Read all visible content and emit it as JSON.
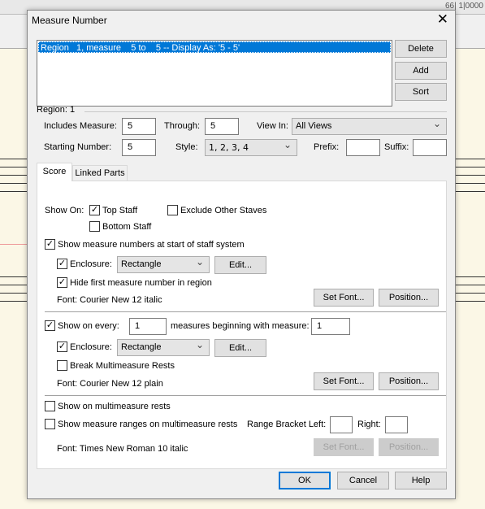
{
  "background": {
    "counter": "66| 1|0000"
  },
  "dialog": {
    "title": "Measure Number",
    "regions": [
      "Region   1, measure    5 to    5 -- Display As: '5 - 5'"
    ],
    "buttons": {
      "delete": "Delete",
      "add": "Add",
      "sort": "Sort",
      "ok": "OK",
      "cancel": "Cancel",
      "help": "Help"
    },
    "region_label": "Region: 1",
    "includes_label": "Includes Measure:",
    "includes_value": "5",
    "through_label": "Through:",
    "through_value": "5",
    "viewin_label": "View In:",
    "viewin_value": "All Views",
    "starting_label": "Starting Number:",
    "starting_value": "5",
    "style_label": "Style:",
    "style_value": "1, 2, 3, 4",
    "prefix_label": "Prefix:",
    "prefix_value": "",
    "suffix_label": "Suffix:",
    "suffix_value": "",
    "tabs": [
      "Score",
      "Linked Parts"
    ],
    "score": {
      "show_on": "Show On:",
      "top_staff": "Top Staff",
      "top_staff_checked": true,
      "exclude": "Exclude Other Staves",
      "exclude_checked": false,
      "bottom_staff": "Bottom Staff",
      "bottom_staff_checked": false,
      "s1": {
        "show_start": "Show measure numbers at start of staff system",
        "show_start_checked": true,
        "enclosure": "Enclosure:",
        "enclosure_checked": true,
        "enclosure_value": "Rectangle",
        "edit": "Edit...",
        "hide_first": "Hide first measure number in region",
        "hide_first_checked": true,
        "font": "Font:  Courier New  12  italic",
        "set_font": "Set Font...",
        "position": "Position..."
      },
      "s2": {
        "show_every": "Show on every:",
        "show_every_checked": true,
        "every_value": "1",
        "beginning": "measures beginning with measure:",
        "beginning_value": "1",
        "enclosure": "Enclosure:",
        "enclosure_checked": true,
        "enclosure_value": "Rectangle",
        "edit": "Edit...",
        "break": "Break Multimeasure Rests",
        "break_checked": false,
        "font": "Font:  Courier New  12  plain",
        "set_font": "Set Font...",
        "position": "Position..."
      },
      "s3": {
        "show_multi": "Show on multimeasure rests",
        "show_multi_checked": false,
        "show_ranges": "Show measure ranges on multimeasure rests",
        "show_ranges_checked": false,
        "bracket_left": "Range Bracket Left:",
        "bracket_left_value": "",
        "right": "Right:",
        "right_value": "",
        "font": "Font:  Times New Roman  10  italic",
        "set_font": "Set Font...",
        "position": "Position..."
      }
    }
  }
}
